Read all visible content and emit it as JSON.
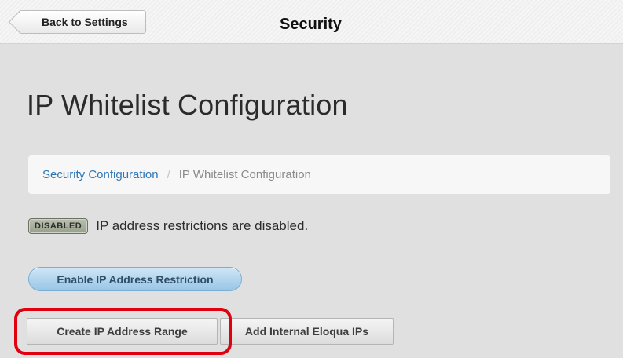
{
  "header": {
    "back_label": "Back to Settings",
    "title": "Security"
  },
  "page": {
    "title": "IP Whitelist Configuration"
  },
  "breadcrumb": {
    "items": [
      {
        "label": "Security Configuration"
      },
      {
        "label": "IP Whitelist Configuration"
      }
    ],
    "separator": "/"
  },
  "status": {
    "badge": "DISABLED",
    "message": "IP address restrictions are disabled."
  },
  "actions": {
    "enable_label": "Enable IP Address Restriction",
    "create_label": "Create IP Address Range",
    "add_label": "Add Internal Eloqua IPs"
  },
  "colors": {
    "link": "#2f75b5",
    "highlight": "#e0000f",
    "enable_button": "#98c6e6"
  }
}
